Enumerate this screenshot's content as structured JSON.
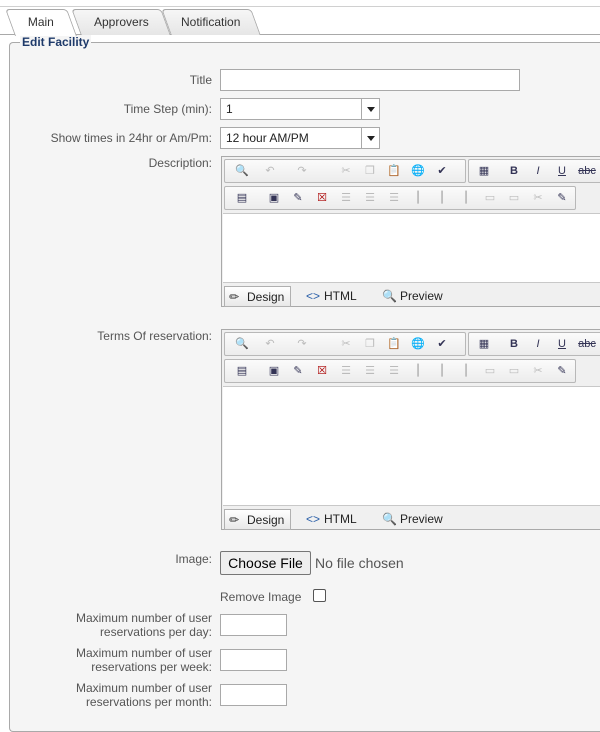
{
  "tabs": [
    {
      "label": "Main",
      "active": true
    },
    {
      "label": "Approvers",
      "active": false
    },
    {
      "label": "Notification",
      "active": false
    }
  ],
  "group_title": "Edit Facility",
  "form": {
    "title_label": "Title",
    "title_value": "",
    "timestep_label": "Time Step (min):",
    "timestep_value": "1",
    "timeformat_label": "Show times in 24hr or Am/Pm:",
    "timeformat_value": "12 hour AM/PM",
    "description_label": "Description:",
    "terms_label": "Terms Of reservation:",
    "image_label": "Image:",
    "choose_file": "Choose File",
    "no_file": "No file chosen",
    "remove_image_label": "Remove Image",
    "max_day_label": "Maximum number of user reservations per day:",
    "max_week_label": "Maximum number of user reservations per week:",
    "max_month_label": "Maximum number of user reservations per month:"
  },
  "editor": {
    "mode_design": "Design",
    "mode_html": "HTML",
    "mode_preview": "Preview"
  },
  "colors": {
    "accent": "#1e3a6a",
    "panel": "#f5f5f5",
    "border": "#a9a9a9"
  }
}
